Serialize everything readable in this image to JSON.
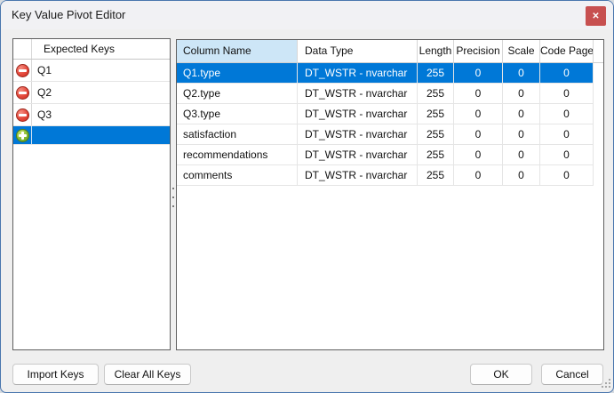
{
  "window": {
    "title": "Key Value Pivot Editor"
  },
  "icons": {
    "close_glyph": "✕",
    "remove": "remove-circle-icon",
    "add": "add-circle-icon"
  },
  "expected_keys": {
    "header": "Expected Keys",
    "items": [
      "Q1",
      "Q2",
      "Q3"
    ],
    "new_row_value": "",
    "selected_row": 3
  },
  "columns_table": {
    "headers": {
      "name": "Column Name",
      "type": "Data Type",
      "length": "Length",
      "precision": "Precision",
      "scale": "Scale",
      "code_page": "Code Page"
    },
    "selected_header": "Column Name",
    "selected_row": 0,
    "rows": [
      {
        "name": "Q1.type",
        "type": "DT_WSTR - nvarchar",
        "length": "255",
        "precision": "0",
        "scale": "0",
        "code_page": "0"
      },
      {
        "name": "Q2.type",
        "type": "DT_WSTR - nvarchar",
        "length": "255",
        "precision": "0",
        "scale": "0",
        "code_page": "0"
      },
      {
        "name": "Q3.type",
        "type": "DT_WSTR - nvarchar",
        "length": "255",
        "precision": "0",
        "scale": "0",
        "code_page": "0"
      },
      {
        "name": "satisfaction",
        "type": "DT_WSTR - nvarchar",
        "length": "255",
        "precision": "0",
        "scale": "0",
        "code_page": "0"
      },
      {
        "name": "recommendations",
        "type": "DT_WSTR - nvarchar",
        "length": "255",
        "precision": "0",
        "scale": "0",
        "code_page": "0"
      },
      {
        "name": "comments",
        "type": "DT_WSTR - nvarchar",
        "length": "255",
        "precision": "0",
        "scale": "0",
        "code_page": "0"
      }
    ]
  },
  "footer": {
    "import_keys": "Import Keys",
    "clear_all_keys": "Clear All Keys",
    "ok": "OK",
    "cancel": "Cancel"
  },
  "colors": {
    "selection_blue": "#0078D7",
    "selected_header_bg": "#CDE6F7",
    "close_button_red": "#C75050",
    "dialog_bg": "#EFEFEF"
  }
}
